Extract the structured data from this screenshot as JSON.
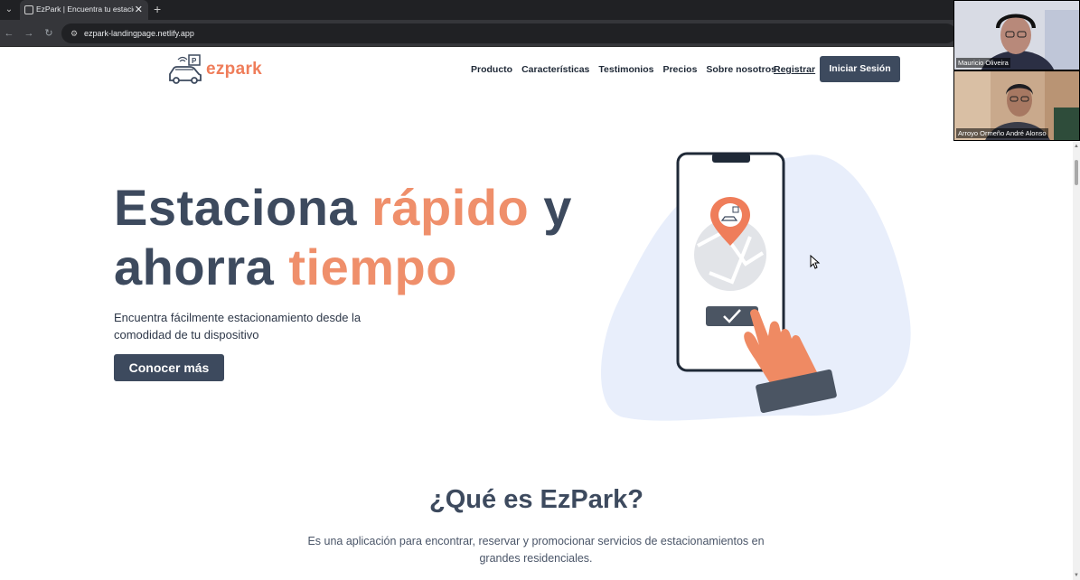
{
  "browser": {
    "tab_title": "EzPark | Encuentra tu estacionar",
    "url": "ezpark-landingpage.netlify.app"
  },
  "header": {
    "logo_text": "ezpark",
    "nav": [
      "Producto",
      "Características",
      "Testimonios",
      "Precios",
      "Sobre nosotros"
    ],
    "register_label": "Registrar",
    "login_label": "Iniciar Sesión"
  },
  "hero": {
    "title_part1": "Estaciona ",
    "title_accent1": "rápido",
    "title_part2": " y",
    "title_part3": "ahorra ",
    "title_accent2": "tiempo",
    "subtitle_line1": "Encuentra fácilmente estacionamiento desde la",
    "subtitle_line2": "comodidad de tu dispositivo",
    "cta_label": "Conocer más"
  },
  "about": {
    "title": "¿Qué es EzPark?",
    "text_line1": "Es una aplicación para encontrar, reservar y promocionar servicios de estacionamientos en",
    "text_line2": "grandes residenciales."
  },
  "participants": [
    {
      "name": "Mauricio Oliveira"
    },
    {
      "name": "Arroyo Ormeño André Alonso"
    }
  ],
  "colors": {
    "primary": "#3d4a5e",
    "accent": "#ef8f6b",
    "blob": "#e8eefb"
  },
  "icons": [
    "tab-menu-icon",
    "close-icon",
    "plus-icon",
    "back-icon",
    "forward-icon",
    "reload-icon",
    "site-settings-icon",
    "car-parking-logo",
    "phone-illustration",
    "check-icon",
    "hand-illustration",
    "cursor-icon"
  ]
}
